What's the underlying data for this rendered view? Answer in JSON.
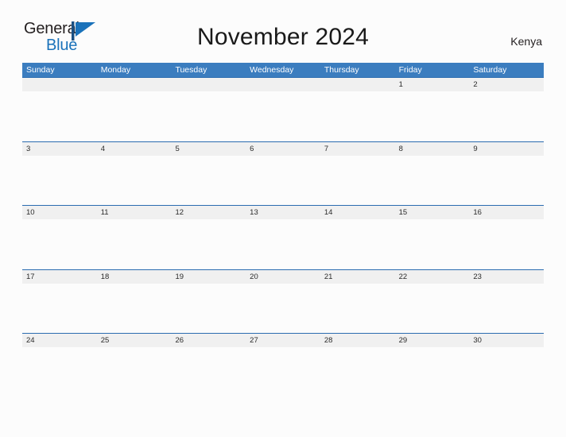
{
  "brand": {
    "name_part1": "General",
    "name_part2": "Blue",
    "mark_icon": "blue-triangle-flag-icon",
    "color_primary": "#1a72ba",
    "color_text": "#231f20"
  },
  "header": {
    "title": "November 2024",
    "region": "Kenya"
  },
  "colors": {
    "header_blue": "#3b7dbf",
    "separator_blue": "#2b6cb0",
    "date_band_gray": "#f0f0f0",
    "page_background": "#fcfcfc"
  },
  "calendar": {
    "weekdays": [
      "Sunday",
      "Monday",
      "Tuesday",
      "Wednesday",
      "Thursday",
      "Friday",
      "Saturday"
    ],
    "weeks": [
      [
        "",
        "",
        "",
        "",
        "",
        "1",
        "2"
      ],
      [
        "3",
        "4",
        "5",
        "6",
        "7",
        "8",
        "9"
      ],
      [
        "10",
        "11",
        "12",
        "13",
        "14",
        "15",
        "16"
      ],
      [
        "17",
        "18",
        "19",
        "20",
        "21",
        "22",
        "23"
      ],
      [
        "24",
        "25",
        "26",
        "27",
        "28",
        "29",
        "30"
      ],
      [
        "",
        "",
        "",
        "",
        "",
        "",
        ""
      ]
    ]
  }
}
